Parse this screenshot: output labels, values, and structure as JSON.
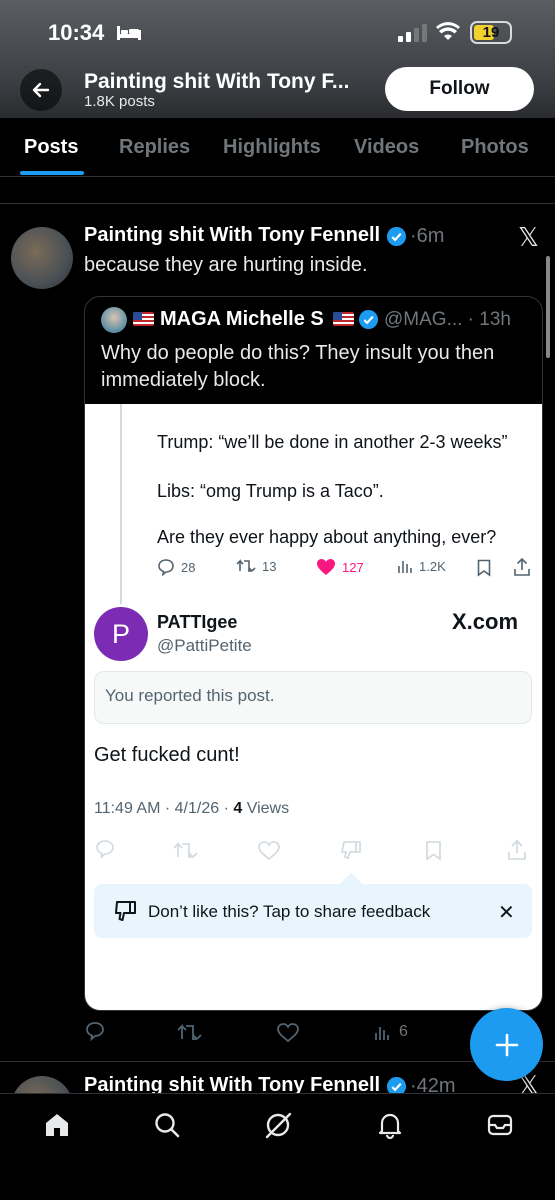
{
  "status_bar": {
    "time": "10:34",
    "battery": "19"
  },
  "header": {
    "profile_name": "Painting shit With Tony F...",
    "post_count": "1.8K posts",
    "follow_label": "Follow"
  },
  "tabs": [
    {
      "label": "Posts",
      "active": true
    },
    {
      "label": "Replies"
    },
    {
      "label": "Highlights"
    },
    {
      "label": "Videos"
    },
    {
      "label": "Photos"
    }
  ],
  "post": {
    "author": "Painting shit With Tony Fennell",
    "time": "·6m",
    "text": "because they are hurting inside.",
    "quote": {
      "author": "MAGA Michelle S",
      "handle": "@MAG... · 13h",
      "text": "Why do people do this?  They insult you then immediately block.",
      "screenshot": {
        "line1": "Trump: “we’ll be done in another 2-3 weeks”",
        "line2": "Libs: “omg Trump is a Taco”.",
        "line3": "Are they ever happy about anything, ever?",
        "replies": "28",
        "reposts": "13",
        "likes": "127",
        "views": "1.2K",
        "reply_author_initial": "P",
        "reply_author": "PATTIgee",
        "reply_handle": "@PattiPetite",
        "site": "X.com",
        "reported_notice": "You reported this post.",
        "reply_text": "Get fucked cunt!",
        "meta_time": "11:49 AM · 4/1/26 · ",
        "meta_views_count": "4",
        "meta_views_label": " Views",
        "feedback_text": "Don’t like this? Tap to share feedback",
        "feedback_close": "✕"
      }
    },
    "actions": {
      "views": "6"
    }
  },
  "next_post": {
    "author": "Painting shit With Tony Fennell",
    "time": "·42m"
  },
  "x_logo": "𝕏",
  "colors": {
    "accent": "#1d9bf0",
    "like": "#f91880",
    "purple_avatar": "#7c2bb5"
  }
}
